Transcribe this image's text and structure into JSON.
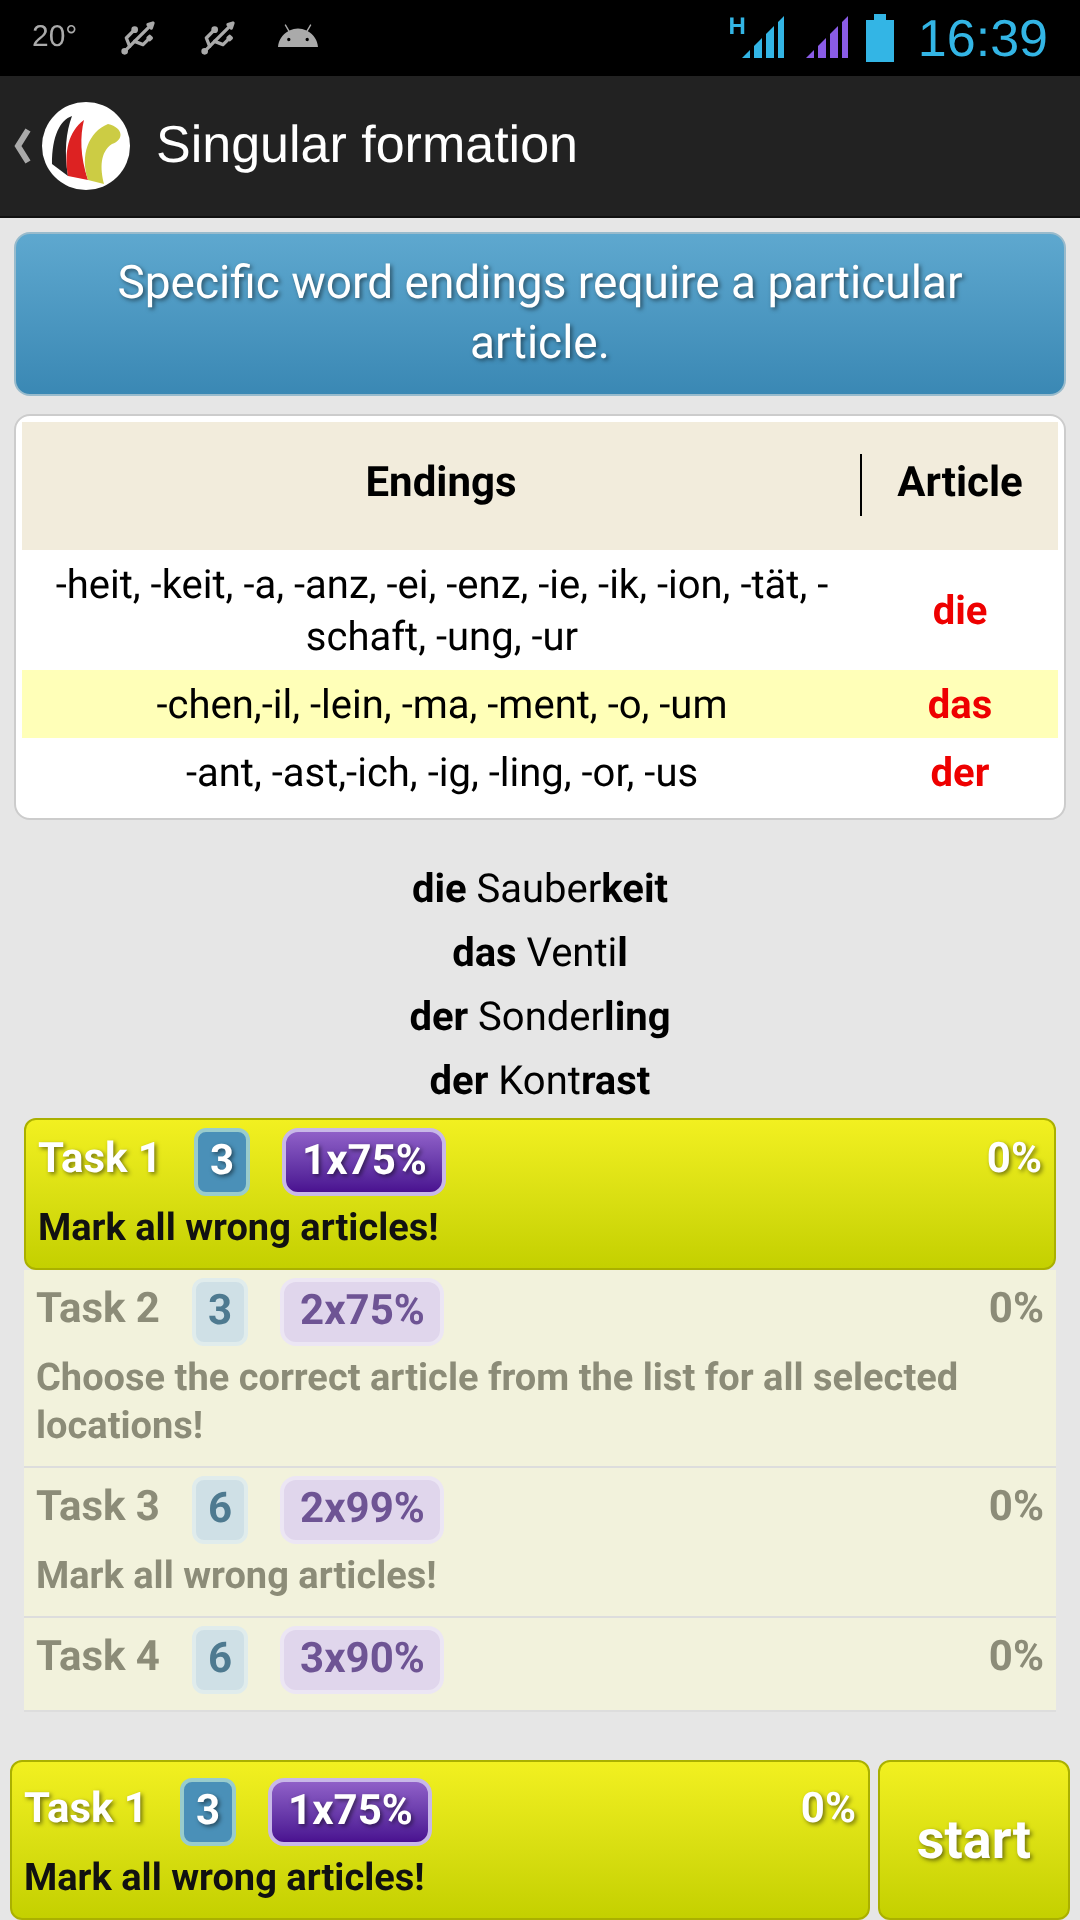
{
  "status_bar": {
    "temperature": "20°",
    "time": "16:39",
    "network_type": "H"
  },
  "action_bar": {
    "title": "Singular formation"
  },
  "header": {
    "text": "Specific word endings require a particular article."
  },
  "table": {
    "columns": [
      "Endings",
      "Article"
    ],
    "rows": [
      {
        "endings": "-heit, -keit, -a, -anz, -ei, -enz, -ie, -ik, -ion, -tät, -schaft, -ung, -ur",
        "article": "die"
      },
      {
        "endings": "-chen,-il, -lein, -ma, -ment, -o, -um",
        "article": "das"
      },
      {
        "endings": "-ant, -ast,-ich, -ig, -ling, -or, -us",
        "article": "der"
      }
    ]
  },
  "examples": [
    "**die** Sauber**keit**",
    "**das** Venti**l**",
    "**der** Sonder**ling**",
    "**der** Kont**rast**"
  ],
  "tasks": [
    {
      "title": "Task 1",
      "count": "3",
      "goal": "1x75%",
      "progress": "0%",
      "description": "Mark all wrong articles!",
      "selected": true
    },
    {
      "title": "Task 2",
      "count": "3",
      "goal": "2x75%",
      "progress": "0%",
      "description": "Choose the correct article from the list for all selected locations!",
      "selected": false
    },
    {
      "title": "Task 3",
      "count": "6",
      "goal": "2x99%",
      "progress": "0%",
      "description": "Mark all wrong articles!",
      "selected": false
    },
    {
      "title": "Task 4",
      "count": "6",
      "goal": "3x90%",
      "progress": "0%",
      "selected": false
    }
  ],
  "current_task": {
    "title": "Task 1",
    "count": "3",
    "goal": "1x75%",
    "progress": "0%",
    "description": "Mark all wrong articles!"
  },
  "start_button": "start"
}
